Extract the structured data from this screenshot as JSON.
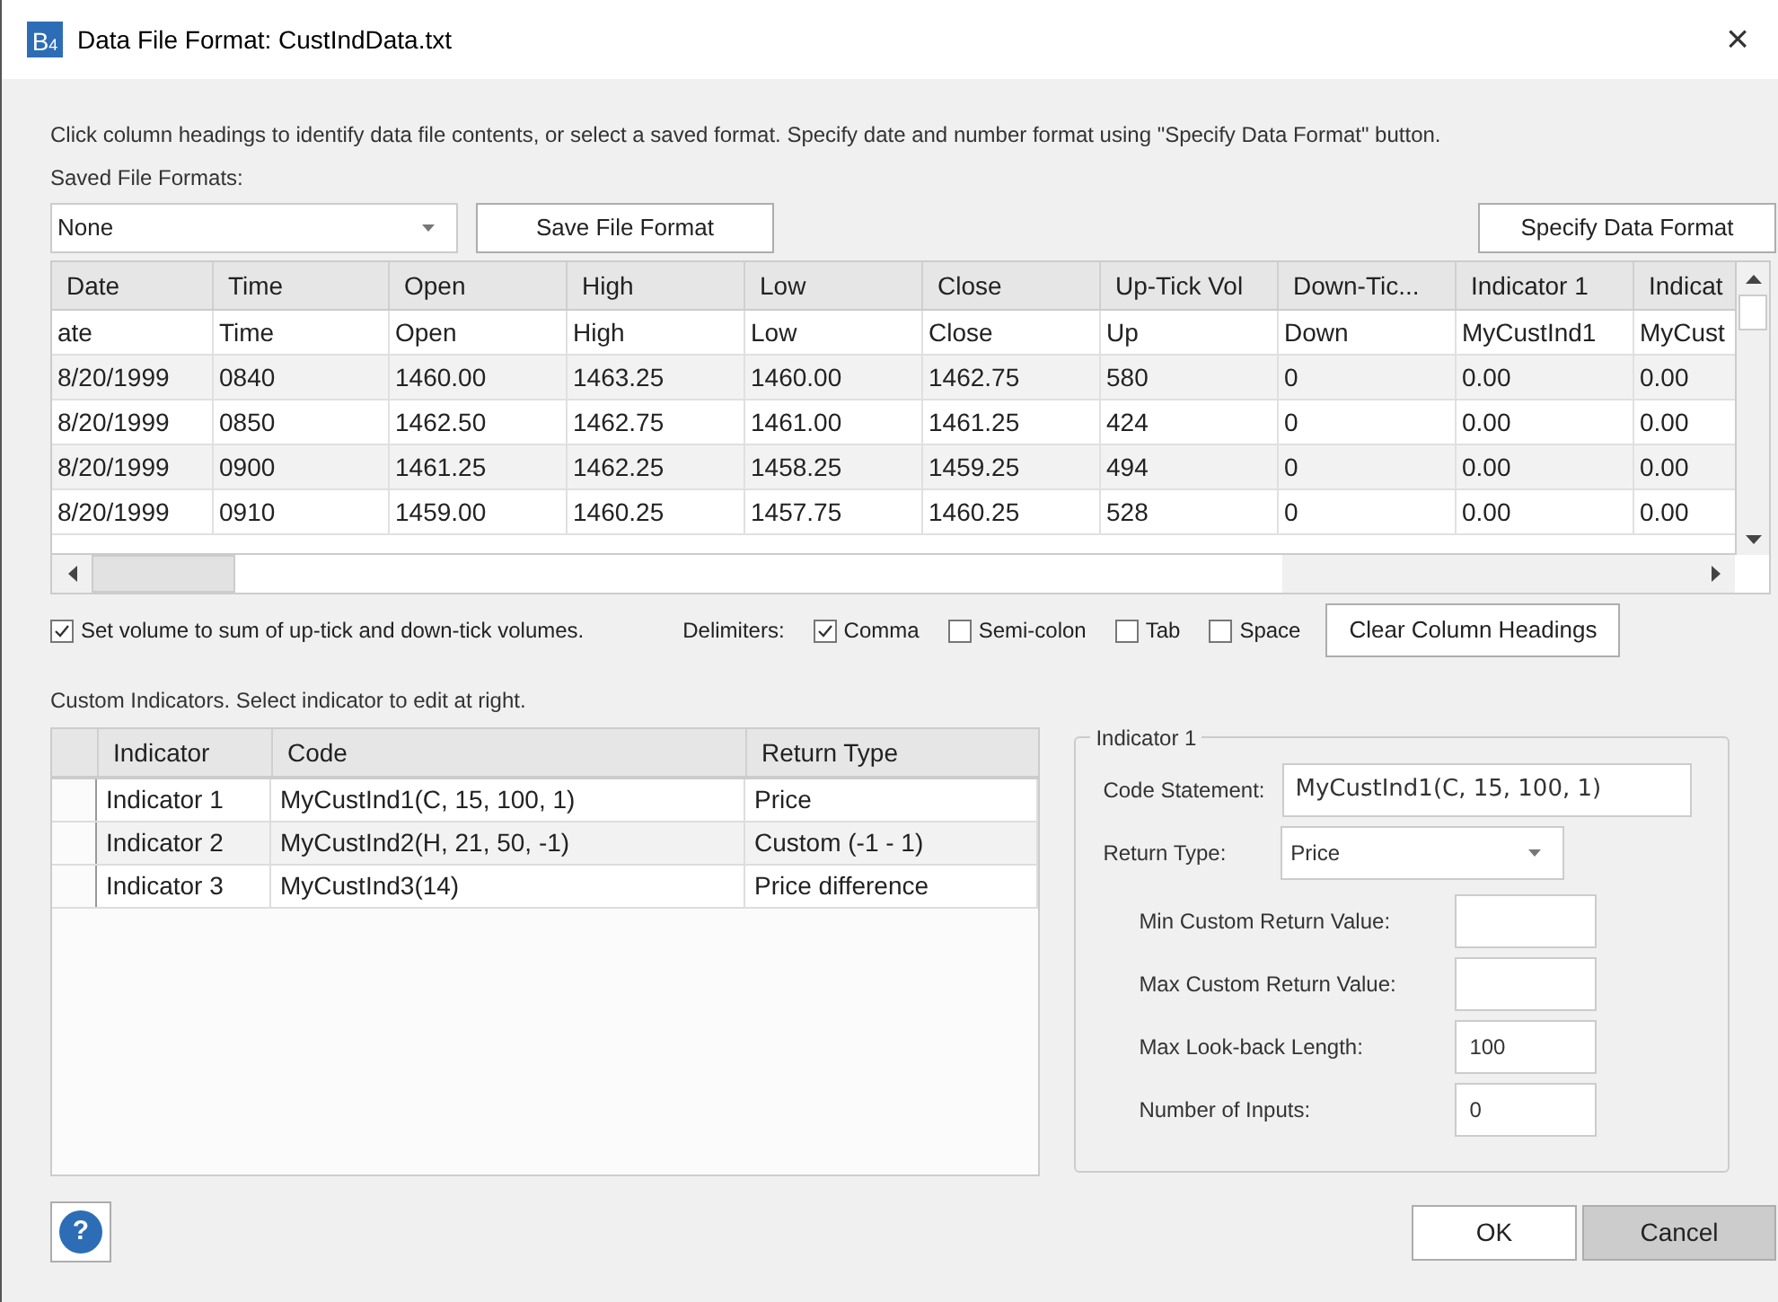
{
  "window": {
    "title": "Data File Format: CustIndData.txt",
    "app_icon_text": "B",
    "app_icon_sub": "4",
    "close": "×"
  },
  "instructions": "Click column headings to identify data file contents, or select a saved format. Specify date and number format using \"Specify Data Format\" button.",
  "saved_formats": {
    "label": "Saved File Formats:",
    "value": "None"
  },
  "buttons_top": [
    "Save File Format",
    "Specify Data Format"
  ],
  "data_grid": {
    "columns": [
      "Date",
      "Time",
      "Open",
      "High",
      "Low",
      "Close",
      "Up-Tick Vol",
      "Down-Tic...",
      "Indicator 1",
      "Indicat"
    ],
    "mapping_row": [
      "ate",
      "Time",
      "Open",
      "High",
      "Low",
      "Close",
      "Up",
      "Down",
      "MyCustInd1",
      "MyCust"
    ],
    "rows": [
      [
        "8/20/1999",
        "0840",
        "1460.00",
        "1463.25",
        "1460.00",
        "1462.75",
        "580",
        "0",
        "0.00",
        "0.00"
      ],
      [
        "8/20/1999",
        "0850",
        "1462.50",
        "1462.75",
        "1461.00",
        "1461.25",
        "424",
        "0",
        "0.00",
        "0.00"
      ],
      [
        "8/20/1999",
        "0900",
        "1461.25",
        "1462.25",
        "1458.25",
        "1459.25",
        "494",
        "0",
        "0.00",
        "0.00"
      ],
      [
        "8/20/1999",
        "0910",
        "1459.00",
        "1460.25",
        "1457.75",
        "1460.25",
        "528",
        "0",
        "0.00",
        "0.00"
      ]
    ]
  },
  "volume_option": {
    "label": "Set volume to sum of up-tick and down-tick volumes.",
    "checked": true
  },
  "delimiters": {
    "label": "Delimiters:",
    "options": [
      {
        "label": "Comma",
        "checked": true
      },
      {
        "label": "Semi-colon",
        "checked": false
      },
      {
        "label": "Tab",
        "checked": false
      },
      {
        "label": "Space",
        "checked": false
      }
    ]
  },
  "clear_button": "Clear Column Headings",
  "indicators_label": "Custom Indicators. Select indicator to edit at right.",
  "indicators_table": {
    "columns": [
      "Indicator",
      "Code",
      "Return Type"
    ],
    "rows": [
      [
        "Indicator 1",
        "MyCustInd1(C, 15, 100, 1)",
        "Price"
      ],
      [
        "Indicator 2",
        "MyCustInd2(H, 21, 50, -1)",
        "Custom (-1 - 1)"
      ],
      [
        "Indicator 3",
        "MyCustInd3(14)",
        "Price difference"
      ]
    ]
  },
  "editor": {
    "title": "Indicator 1",
    "code_label": "Code Statement:",
    "code_value": "MyCustInd1(C, 15, 100, 1)",
    "return_label": "Return Type:",
    "return_value": "Price",
    "fields": [
      {
        "label": "Min Custom Return Value:"
      },
      {
        "label": "Max Custom Return Value:"
      },
      {
        "label": "Max Look-back Length:",
        "value": "100"
      },
      {
        "label": "Number of Inputs:",
        "value": "0"
      }
    ]
  },
  "footer": {
    "help": "?",
    "ok": "OK",
    "cancel": "Cancel"
  }
}
